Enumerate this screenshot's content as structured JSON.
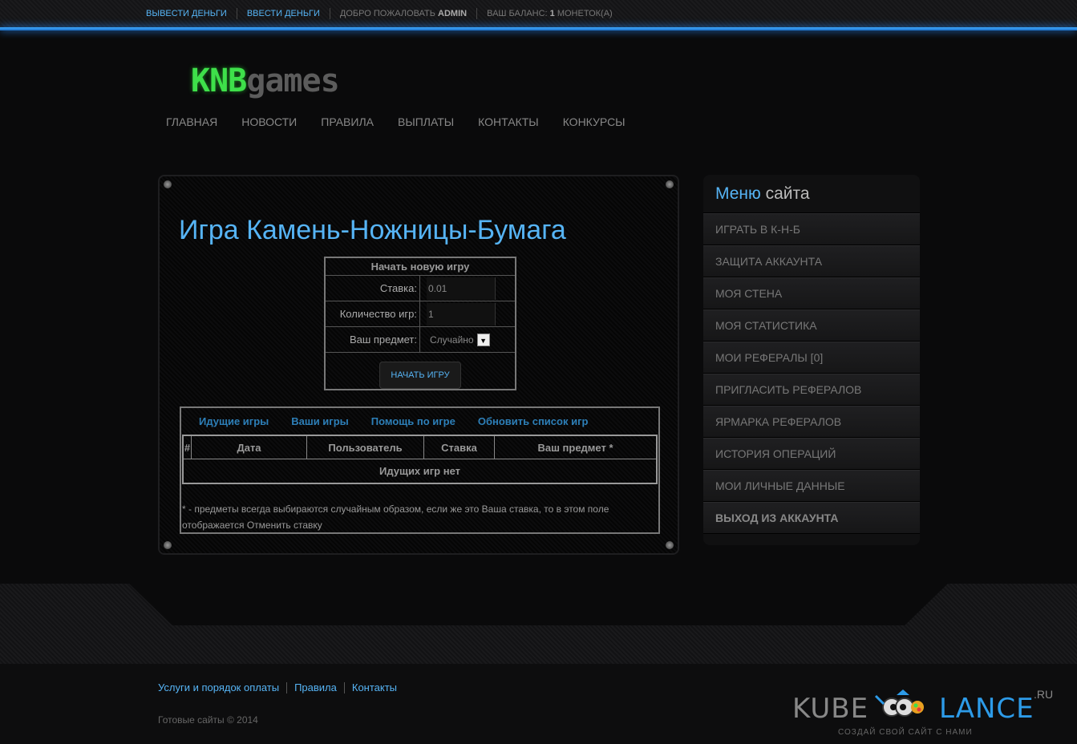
{
  "topbar": {
    "withdraw": "ВЫВЕСТИ ДЕНЬГИ",
    "deposit": "ВВЕСТИ ДЕНЬГИ",
    "welcome_prefix": "ДОБРО ПОЖАЛОВАТЬ ",
    "username": "ADMIN",
    "balance_prefix": "ВАШ БАЛАНС: ",
    "balance_value": "1",
    "balance_suffix": " МОНЕТОК(А)"
  },
  "logo": {
    "part1": "KNB",
    "part2": "games"
  },
  "nav": [
    "ГЛАВНАЯ",
    "НОВОСТИ",
    "ПРАВИЛА",
    "ВЫПЛАТЫ",
    "КОНТАКТЫ",
    "КОНКУРСЫ"
  ],
  "main": {
    "title": "Игра Камень-Ножницы-Бумага",
    "new_game": {
      "header": "Начать новую игру",
      "bet_label": "Ставка:",
      "bet_value": "0.01",
      "count_label": "Количество игр:",
      "count_value": "1",
      "item_label": "Ваш предмет:",
      "item_value": "Случайно",
      "start_button": "НАЧАТЬ ИГРУ"
    },
    "games": {
      "tabs": [
        "Идущие игры",
        "Ваши игры",
        "Помощь по игре",
        "Обновить список игр"
      ],
      "columns": [
        "#",
        "Дата",
        "Пользователь",
        "Ставка",
        "Ваш предмет *"
      ],
      "empty": "Идущих игр нет",
      "note": "* - предметы всегда выбираются случайным образом, если же это Ваша ставка, то в этом поле отображается Отменить ставку"
    }
  },
  "sidebar": {
    "title_blue": "Меню",
    "title_rest": " сайта",
    "items": [
      "ИГРАТЬ В К-Н-Б",
      "ЗАЩИТА АККАУНТА",
      "МОЯ СТЕНА",
      "МОЯ СТАТИСТИКА",
      "МОИ РЕФЕРАЛЫ [0]",
      "ПРИГЛАСИТЬ РЕФЕРАЛОВ",
      "ЯРМАРКА РЕФЕРАЛОВ",
      "ИСТОРИЯ ОПЕРАЦИЙ",
      "МОИ ЛИЧНЫЕ ДАННЫЕ"
    ],
    "logout": "ВЫХОД ИЗ АККАУНТА"
  },
  "footer": {
    "links": [
      "Услуги и порядок оплаты",
      "Правила",
      "Контакты"
    ],
    "copyright": "Готовые сайты © 2014",
    "brand": {
      "left": "KUBE",
      "right": "LANCE",
      "tld": ".RU",
      "slogan": "СОЗДАЙ СВОЙ САЙТ С НАМИ"
    }
  },
  "colors": {
    "accent": "#56b4f5",
    "logo_green": "#3ee04a",
    "topline": "#2a8cff"
  }
}
